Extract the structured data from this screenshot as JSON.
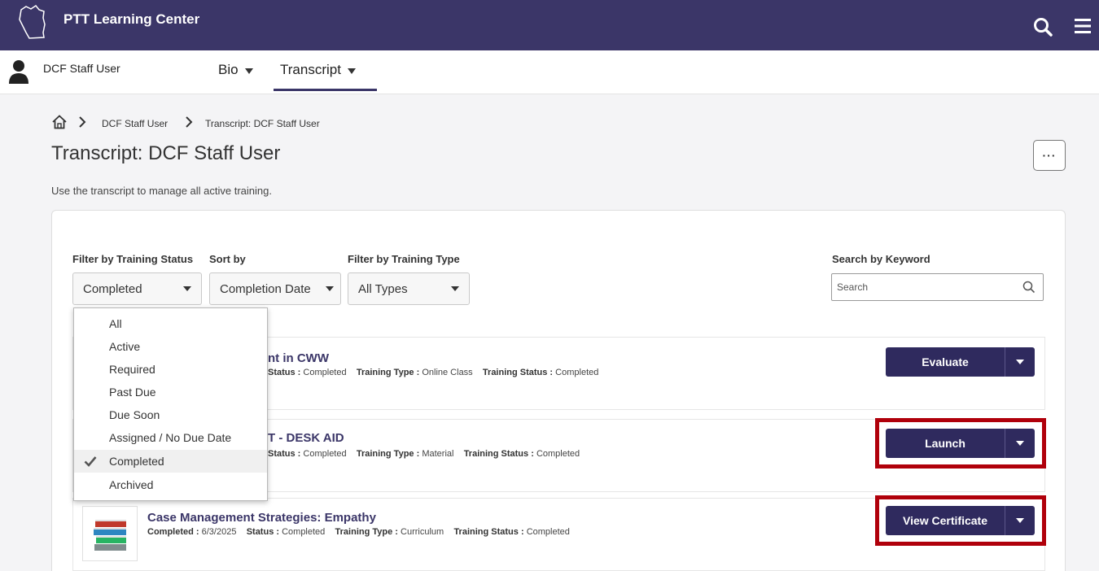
{
  "header": {
    "app_title": "PTT Learning Center"
  },
  "user": {
    "name": "DCF Staff User"
  },
  "nav": {
    "tabs": [
      {
        "label": "Bio"
      },
      {
        "label": "Transcript"
      }
    ]
  },
  "breadcrumb": {
    "items": [
      "DCF Staff User",
      "Transcript: DCF Staff User"
    ]
  },
  "page": {
    "title": "Transcript: DCF Staff User",
    "description": "Use the transcript to manage all active training.",
    "more_label": "···"
  },
  "filters": {
    "status_label": "Filter by Training Status",
    "status_value": "Completed",
    "sort_label": "Sort by",
    "sort_value": "Completion Date",
    "type_label": "Filter by Training Type",
    "type_value": "All Types",
    "keyword_label": "Search by Keyword",
    "keyword_placeholder": "Search"
  },
  "status_dropdown": {
    "options": [
      "All",
      "Active",
      "Required",
      "Past Due",
      "Due Soon",
      "Assigned / No Due Date",
      "Completed",
      "Archived"
    ],
    "selected": "Completed"
  },
  "rows": [
    {
      "title_visible": "nt in CWW",
      "status_tail": "Status :",
      "status": "Completed",
      "type_label": "Training Type :",
      "type": "Online Class",
      "tstatus_label": "Training Status :",
      "tstatus": "Completed",
      "action": "Evaluate"
    },
    {
      "title_visible": "T - DESK AID",
      "status_tail": "Status :",
      "status": "Completed",
      "type_label": "Training Type :",
      "type": "Material",
      "tstatus_label": "Training Status :",
      "tstatus": "Completed",
      "action": "Launch"
    },
    {
      "title": "Case Management Strategies: Empathy",
      "completed_label": "Completed :",
      "completed": "6/3/2025",
      "status_tail": "Status :",
      "status": "Completed",
      "type_label": "Training Type :",
      "type": "Curriculum",
      "tstatus_label": "Training Status :",
      "tstatus": "Completed",
      "action": "View Certificate"
    }
  ],
  "colors": {
    "header_bg": "#3b3668",
    "button_bg": "#2f2a5e",
    "highlight": "#b0000b"
  }
}
